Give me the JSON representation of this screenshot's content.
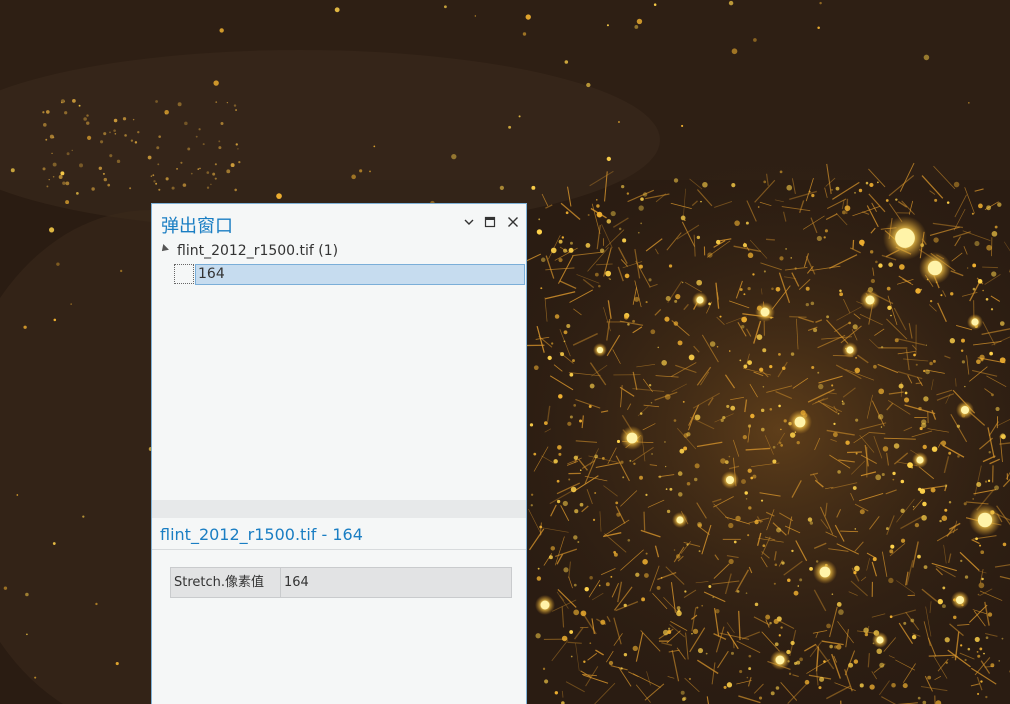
{
  "popup": {
    "title": "弹出窗口",
    "controls": {
      "collapse_icon": "chevron-down-icon",
      "maximize_icon": "maximize-icon",
      "close_icon": "close-icon"
    },
    "tree": {
      "layer_label": "flint_2012_r1500.tif (1)",
      "item_label": "164"
    },
    "detail": {
      "title": "flint_2012_r1500.tif - 164",
      "rows": [
        {
          "field": "Stretch.像素值",
          "value": "164"
        }
      ]
    }
  },
  "colors": {
    "accent": "#1a7ec3",
    "selection": "#c6dcef",
    "map_background": "#2a1c12",
    "city_lights": "#f0c040"
  }
}
